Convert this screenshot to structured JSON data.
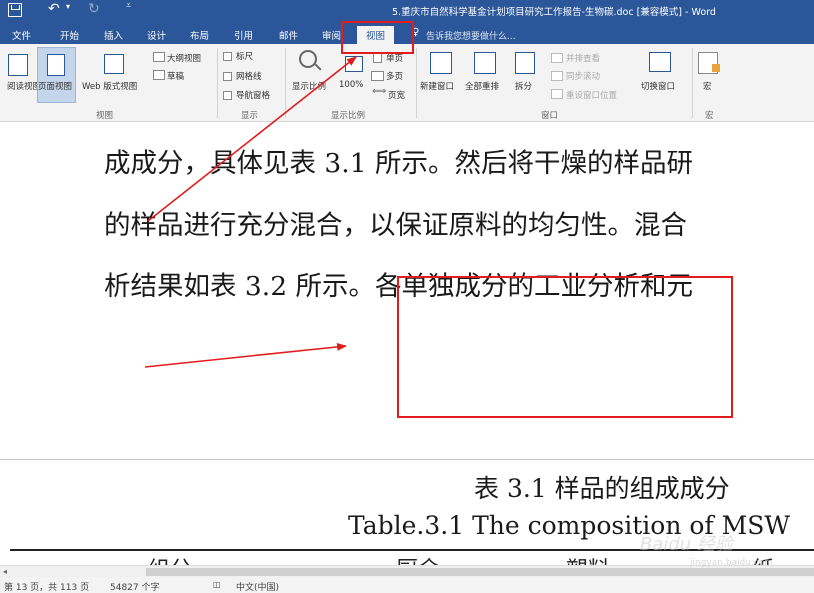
{
  "titlebar": {
    "doc_title": "5.重庆市自然科学基金计划项目研究工作报告-生物碳.doc [兼容模式] - Word"
  },
  "tabs": [
    {
      "label": "文件"
    },
    {
      "label": "开始"
    },
    {
      "label": "插入"
    },
    {
      "label": "设计"
    },
    {
      "label": "布局"
    },
    {
      "label": "引用"
    },
    {
      "label": "邮件"
    },
    {
      "label": "审阅"
    },
    {
      "label": "视图"
    }
  ],
  "tell_me": {
    "placeholder": "告诉我您想要做什么..."
  },
  "ribbon": {
    "views": {
      "read_mode": "阅读视图",
      "print_layout": "页面视图",
      "web_layout": "Web 版式视图",
      "outline": "大纲视图",
      "draft": "草稿",
      "group": "视图"
    },
    "show": {
      "ruler": "标尺",
      "gridlines": "网格线",
      "nav_pane": "导航窗格",
      "group": "显示"
    },
    "zoom": {
      "zoom": "显示比例",
      "zoom_100": "100%",
      "one_page": "单页",
      "multiple_pages": "多页",
      "page_width": "页宽",
      "group": "显示比例"
    },
    "window": {
      "new_window": "新建窗口",
      "arrange_all": "全部重排",
      "split": "拆分",
      "side_by_side": "并排查看",
      "sync_scroll": "同步滚动",
      "reset_position": "重设窗口位置",
      "switch_windows": "切换窗口",
      "group": "窗口"
    },
    "macros": {
      "macros": "宏",
      "group": "宏"
    }
  },
  "document": {
    "lines": [
      "成成分，具体见表 3.1 所示。然后将干燥的样品研",
      "的样品进行充分混合，以保证原料的均匀性。混合",
      "析结果如表 3.2 所示。各单独成分的工业分析和元"
    ],
    "table_caption_cn": "表 3.1  样品的组成成分",
    "table_caption_en": "Table.3.1 The composition of MSW",
    "table_headers": [
      "组分",
      "厨余",
      "塑料",
      "纸"
    ]
  },
  "status": {
    "page": "第 13 页，共 113 页",
    "words": "54827 个字",
    "language": "中文(中国)"
  },
  "watermark": {
    "text": "Baidu 经验",
    "url": "jingyan.baidu.com"
  },
  "colors": {
    "accent": "#2b579a",
    "annotation": "#e01c1c"
  }
}
